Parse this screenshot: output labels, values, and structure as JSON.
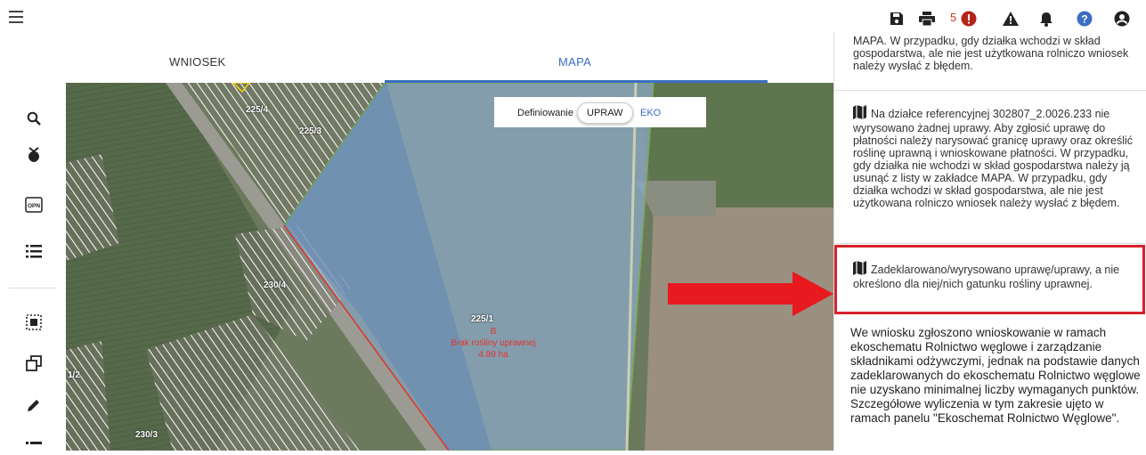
{
  "header": {
    "tabs": [
      {
        "label": "WNIOSEK"
      },
      {
        "label": "MAPA"
      }
    ],
    "notification_count": "5",
    "icons": [
      "save-icon",
      "print-icon",
      "error-icon",
      "warning-icon",
      "bell-icon",
      "help-icon",
      "account-icon"
    ],
    "accent_color": "#3b6ec2",
    "error_color": "#c23a1a"
  },
  "sidebar": {
    "icons": [
      "search-icon",
      "plant-icon",
      "opn-icon",
      "list-icon",
      "select-area-icon",
      "copy-icon",
      "edit-icon",
      "more-list-icon"
    ],
    "opn_label": "OPN"
  },
  "map": {
    "define_label": "Definiowanie",
    "upraw_label": "UPRAW",
    "eko_label": "EKO",
    "parcels": [
      "225/4",
      "225/3",
      "230/4",
      "1/2",
      "230/3"
    ],
    "selected_parcel": {
      "number": "225/1",
      "crop": "B",
      "status": "Brak rośliny uprawnej",
      "area": "4.89 ha"
    }
  },
  "panel": {
    "messages": [
      {
        "text": "MAPA. W przypadku, gdy działka wchodzi w skład gospodarstwa, ale nie jest użytkowana rolniczo wniosek należy wysłać z błędem."
      },
      {
        "text": "Na działce referencyjnej 302807_2.0026.233 nie wyrysowano żadnej uprawy. Aby zgłosić uprawę do płatności należy narysować granicę uprawy oraz określić roślinę uprawną i wnioskowane płatności. W przypadku, gdy działka nie wchodzi w skład gospodarstwa należy ją usunąć z listy w zakładce MAPA. W przypadku, gdy działka wchodzi w skład gospodarstwa, ale nie jest użytkowana rolniczo wniosek należy wysłać z błędem."
      },
      {
        "text": "Zadeklarowano/wyrysowano uprawę/uprawy, a nie określono dla niej/nich gatunku rośliny uprawnej."
      }
    ],
    "final_text": "We wniosku zgłoszono wnioskowanie w ramach ekoschematu Rolnictwo węglowe i zarządzanie składnikami odżywczymi, jednak na podstawie danych zadeklarowanych do ekoschematu Rolnictwo węglowe nie uzyskano minimalnej liczby wymaganych punktów. Szczegółowe wyliczenia w tym zakresie ujęto w ramach panelu \"Ekoschemat Rolnictwo Węglowe\"."
  }
}
